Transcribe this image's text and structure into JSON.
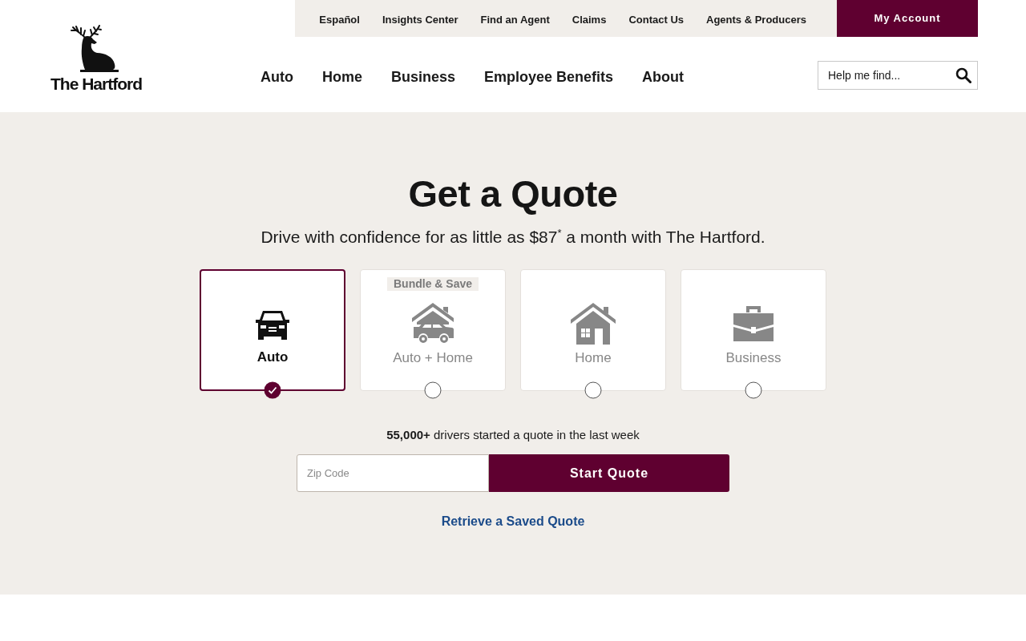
{
  "utility_nav": {
    "links": [
      "Español",
      "Insights Center",
      "Find an Agent",
      "Claims",
      "Contact Us",
      "Agents & Producers"
    ],
    "account_button": "My Account"
  },
  "logo": {
    "wordmark": "The Hartford"
  },
  "main_nav": {
    "items": [
      "Auto",
      "Home",
      "Business",
      "Employee Benefits",
      "About"
    ]
  },
  "search": {
    "placeholder": "Help me find..."
  },
  "quote": {
    "title": "Get a Quote",
    "subtitle": "Drive with confidence for as little as $87$^{*}$ a month with The Hartford.",
    "options": [
      {
        "kind": "auto",
        "label": "Auto",
        "selected": true
      },
      {
        "kind": "bundle",
        "label": "Auto + Home",
        "badge": "Bundle & Save",
        "selected": false
      },
      {
        "kind": "home",
        "label": "Home",
        "selected": false
      },
      {
        "kind": "business",
        "label": "Business",
        "selected": false
      }
    ],
    "social_proof": "**55,000+** drivers started a quote in the last week",
    "zip_field": {
      "placeholder": "Zip Code"
    },
    "submit_button": "Start Quote",
    "retrieve_link": "Retrieve a Saved Quote"
  }
}
